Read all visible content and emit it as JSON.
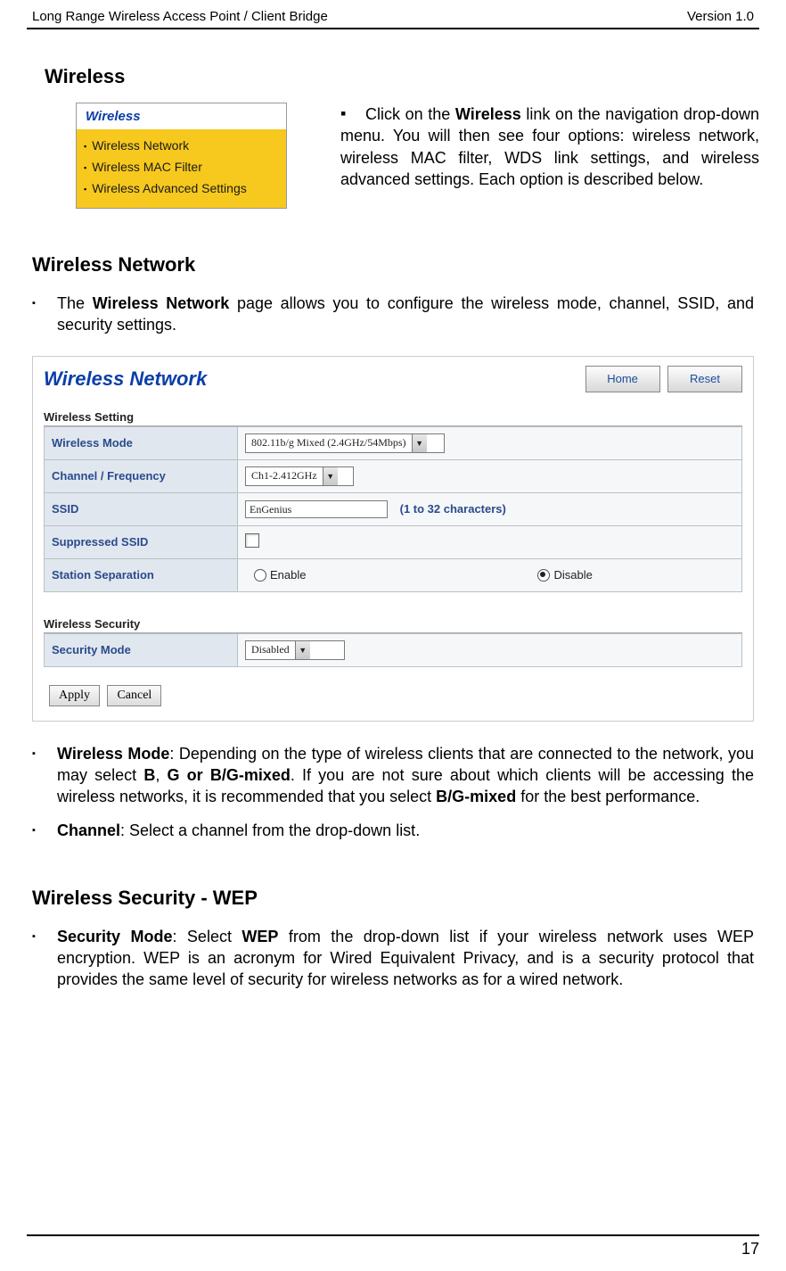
{
  "header": {
    "left": "Long Range Wireless Access Point / Client Bridge",
    "right": "Version 1.0"
  },
  "sections": {
    "wireless_title": "Wireless",
    "network_title": "Wireless Network",
    "security_title": "Wireless Security - WEP"
  },
  "sidenav": {
    "header": "Wireless",
    "items": [
      "Wireless Network",
      "Wireless MAC Filter",
      "Wireless Advanced Settings"
    ]
  },
  "intro_paragraph": {
    "pre": "Click on the ",
    "bold1": "Wireless",
    "post": " link on the navigation drop-down menu. You will then see four options: wireless network, wireless MAC filter, WDS link settings, and wireless advanced settings. Each option is described below."
  },
  "network_intro": {
    "pre": "The ",
    "bold": "Wireless Network",
    "post": " page allows you to configure the wireless mode, channel, SSID, and security settings."
  },
  "screenshot": {
    "title": "Wireless Network",
    "tabs": {
      "home": "Home",
      "reset": "Reset"
    },
    "group1": "Wireless Setting",
    "group2": "Wireless Security",
    "rows": {
      "mode_label": "Wireless Mode",
      "mode_value": "802.11b/g Mixed (2.4GHz/54Mbps)",
      "chan_label": "Channel / Frequency",
      "chan_value": "Ch1-2.412GHz",
      "ssid_label": "SSID",
      "ssid_value": "EnGenius",
      "ssid_hint": "(1 to 32 characters)",
      "supp_label": "Suppressed SSID",
      "sep_label": "Station Separation",
      "sep_enable": "Enable",
      "sep_disable": "Disable",
      "sec_label": "Security Mode",
      "sec_value": "Disabled"
    },
    "buttons": {
      "apply": "Apply",
      "cancel": "Cancel"
    }
  },
  "bullets": {
    "mode": {
      "label": "Wireless Mode",
      "text1": ": Depending on the type of wireless clients that are connected to the network, you may select ",
      "b1": "B",
      "c1": ", ",
      "b2": "G or B/G-mixed",
      "text2": ". If you are not sure about which clients will be accessing the wireless networks, it is recommended that you select ",
      "b3": "B/G-mixed",
      "text3": " for the best performance."
    },
    "channel": {
      "label": "Channel",
      "text": ": Select a channel from the drop-down list."
    },
    "security": {
      "label": "Security Mode",
      "text1": ": Select ",
      "b1": "WEP",
      "text2": " from the drop-down list if your wireless network uses WEP encryption. WEP is an acronym for Wired Equivalent Privacy, and is a security protocol that provides the same level of security for wireless networks as for a wired network."
    }
  },
  "page_number": "17"
}
